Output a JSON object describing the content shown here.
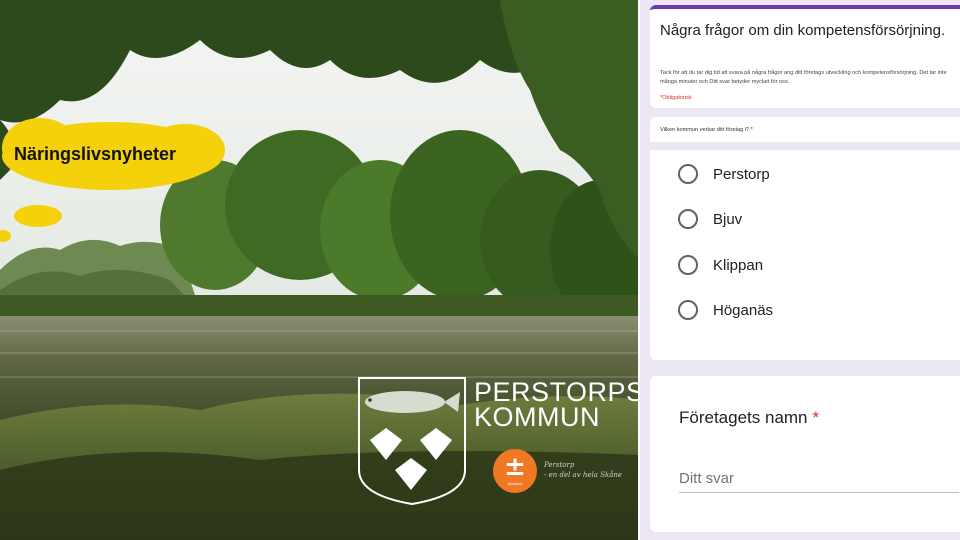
{
  "photo": {
    "headline": "Näringslivsnyheter",
    "logo_line1": "PERSTORPS",
    "logo_line2": "KOMMUN",
    "badge_symbol": "±",
    "badge_tag": "plusplus",
    "script_line1": "Perstorp",
    "script_line2": "- en del av hela Skåne",
    "bubble_color": "#f5d10c",
    "badge_color": "#f07824"
  },
  "form": {
    "title": "Några frågor om din kompetensförsörjning.",
    "description": "Tack för att du tar dig tid att svara på några frågor ang ditt företags utveckling och kompetensförsörjning. Det tar inte många minuter och Ditt svar betyder mycket för oss.",
    "required_note": "*Obligatorisk",
    "question1": {
      "label": "Vilken kommun verkar ditt företag i? *",
      "options": [
        "Perstorp",
        "Bjuv",
        "Klippan",
        "Höganäs"
      ]
    },
    "question2": {
      "label": "Företagets namn",
      "required_mark": "*",
      "placeholder": "Ditt svar"
    },
    "accent_color": "#673ab7",
    "background_color": "#ede7f5"
  }
}
